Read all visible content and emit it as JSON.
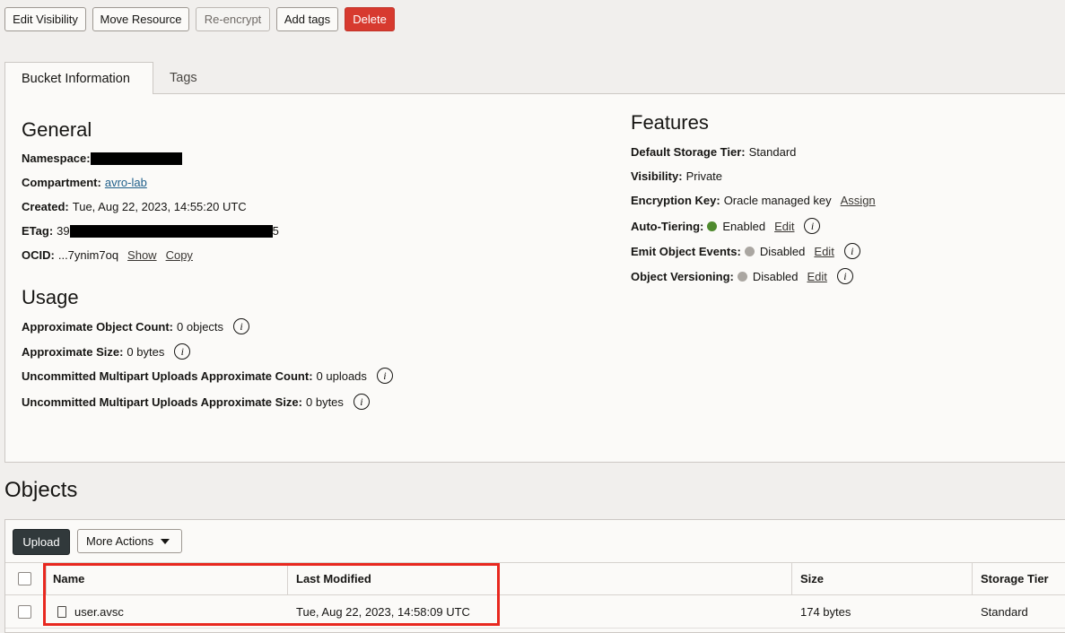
{
  "toolbar": {
    "edit_visibility": "Edit Visibility",
    "move_resource": "Move Resource",
    "re_encrypt": "Re-encrypt",
    "add_tags": "Add tags",
    "delete": "Delete"
  },
  "tabs": {
    "bucket_information": "Bucket Information",
    "tags": "Tags"
  },
  "general": {
    "title": "General",
    "namespace_label": "Namespace:",
    "compartment_label": "Compartment:",
    "compartment_value": "avro-lab",
    "created_label": "Created:",
    "created_value": "Tue, Aug 22, 2023, 14:55:20 UTC",
    "etag_label": "ETag:",
    "etag_prefix": "39",
    "etag_suffix": "5",
    "ocid_label": "OCID:",
    "ocid_value": "...7ynim7oq",
    "show": "Show",
    "copy": "Copy"
  },
  "usage": {
    "title": "Usage",
    "object_count_label": "Approximate Object Count:",
    "object_count_value": "0 objects",
    "size_label": "Approximate Size:",
    "size_value": "0 bytes",
    "multipart_count_label": "Uncommitted Multipart Uploads Approximate Count:",
    "multipart_count_value": "0 uploads",
    "multipart_size_label": "Uncommitted Multipart Uploads Approximate Size:",
    "multipart_size_value": "0 bytes"
  },
  "features": {
    "title": "Features",
    "storage_tier_label": "Default Storage Tier:",
    "storage_tier_value": "Standard",
    "visibility_label": "Visibility:",
    "visibility_value": "Private",
    "encryption_label": "Encryption Key:",
    "encryption_value": "Oracle managed key",
    "assign": "Assign",
    "auto_tiering_label": "Auto-Tiering:",
    "auto_tiering_value": "Enabled",
    "emit_events_label": "Emit Object Events:",
    "emit_events_value": "Disabled",
    "versioning_label": "Object Versioning:",
    "versioning_value": "Disabled",
    "edit": "Edit",
    "info_glyph": "i"
  },
  "objects": {
    "title": "Objects",
    "upload": "Upload",
    "more_actions": "More Actions",
    "columns": {
      "name": "Name",
      "last_modified": "Last Modified",
      "size": "Size",
      "storage_tier": "Storage Tier"
    },
    "rows": [
      {
        "name": "user.avsc",
        "last_modified": "Tue, Aug 22, 2023, 14:58:09 UTC",
        "size": "174 bytes",
        "storage_tier": "Standard"
      }
    ]
  },
  "colors": {
    "enabled": "#4f8a2e",
    "disabled": "#aaa6a1",
    "delete": "#d73a2f",
    "highlight": "#e8281f"
  }
}
